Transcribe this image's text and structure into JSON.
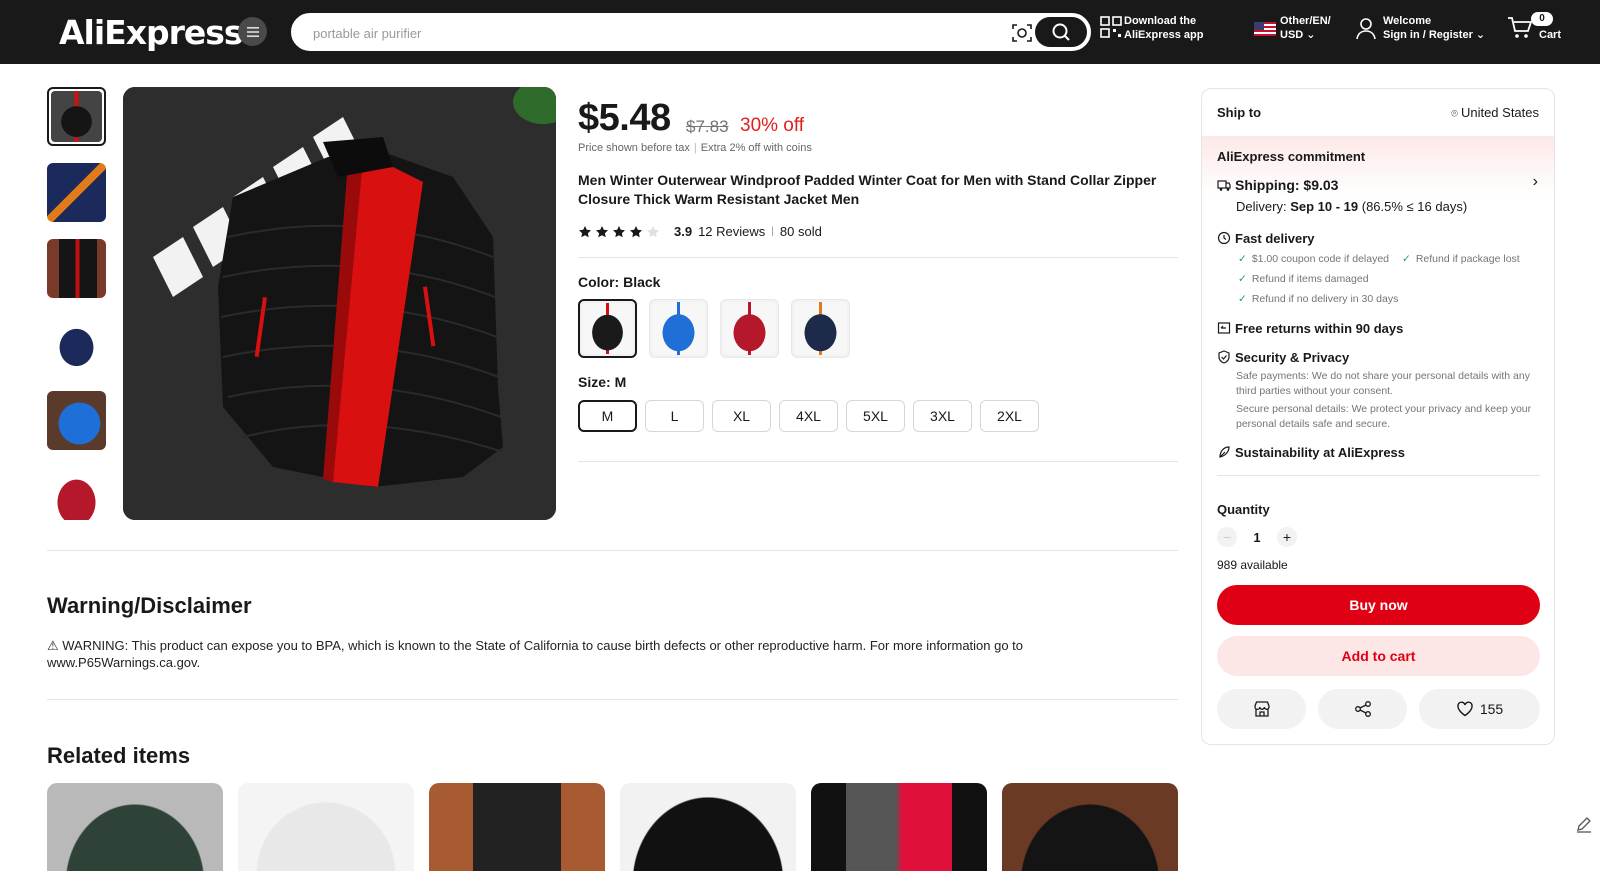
{
  "header": {
    "logo_text": "AliExpress",
    "search_placeholder": "portable air purifier",
    "app_line1": "Download the",
    "app_line2": "AliExpress app",
    "lang_line1": "Other/EN/",
    "lang_line2": "USD",
    "account_line1": "Welcome",
    "account_line2": "Sign in / Register",
    "cart_count": "0",
    "cart_label": "Cart"
  },
  "product": {
    "price": "$5.48",
    "original_price": "$7.83",
    "discount": "30% off",
    "tax_note": "Price shown before tax",
    "coins_note": "Extra 2% off with coins",
    "title": "Men Winter Outerwear Windproof Padded Winter Coat for Men with Stand Collar Zipper Closure Thick Warm Resistant Jacket Men",
    "rating": "3.9",
    "rating_value": 3.9,
    "reviews": "12 Reviews",
    "sold": "80 sold",
    "color_label": "Color: ",
    "color_value": "Black",
    "size_label": "Size: ",
    "size_value": "M",
    "sizes": [
      "M",
      "L",
      "XL",
      "4XL",
      "5XL",
      "3XL",
      "2XL"
    ],
    "colors": [
      "#1a1a1a",
      "#1f6fd6",
      "#b5172b",
      "#1e2a4a"
    ]
  },
  "disclaimer": {
    "heading": "Warning/Disclaimer",
    "text": "⚠ WARNING: This product can expose you to BPA, which is known to the State of California to cause birth defects or other reproductive harm. For more information go to www.P65Warnings.ca.gov."
  },
  "related": {
    "heading": "Related items"
  },
  "panel": {
    "ship_to": "Ship to",
    "destination": "United States",
    "commitment": "AliExpress commitment",
    "shipping": "Shipping: $9.03",
    "delivery_prefix": "Delivery: ",
    "delivery_dates": "Sep 10 - 19",
    "delivery_suffix": " (86.5% ≤ 16 days)",
    "fast_delivery": "Fast delivery",
    "fd_items": [
      "$1.00 coupon code if delayed",
      "Refund if package lost",
      "Refund if items damaged",
      "Refund if no delivery in 30 days"
    ],
    "free_returns": "Free returns within 90 days",
    "security": "Security & Privacy",
    "security_1": "Safe payments: We do not share your personal details with any third parties without your consent.",
    "security_2": "Secure personal details: We protect your privacy and keep your personal details safe and secure.",
    "sustainability": "Sustainability at AliExpress",
    "quantity_label": "Quantity",
    "quantity": "1",
    "available": "989 available",
    "buy_now": "Buy now",
    "add_to_cart": "Add to cart",
    "wishlist_count": "155"
  }
}
